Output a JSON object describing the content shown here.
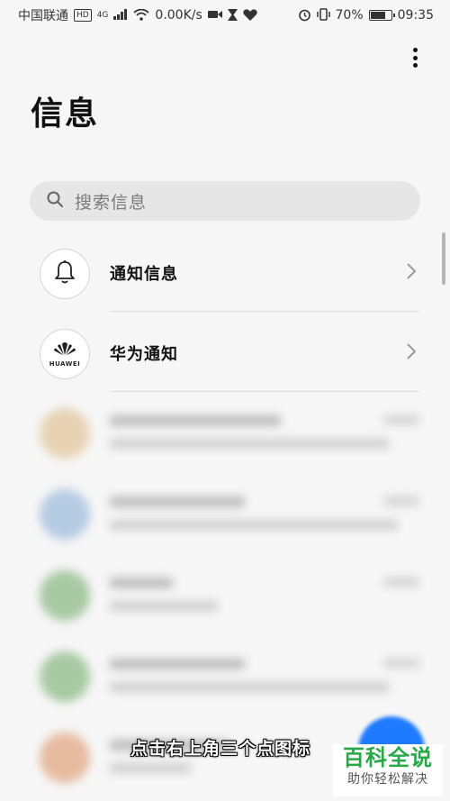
{
  "status_bar": {
    "carrier": "中国联通",
    "hd": "HD",
    "network": "4G",
    "speed": "0.00K/s",
    "battery": "70%",
    "battery_level": 0.7,
    "time": "09:35"
  },
  "header": {
    "title": "信息"
  },
  "search": {
    "placeholder": "搜索信息"
  },
  "list": {
    "items": [
      {
        "label": "通知信息",
        "icon": "bell-icon"
      },
      {
        "label": "华为通知",
        "icon": "huawei-logo-icon",
        "logo_text": "HUAWEI"
      }
    ]
  },
  "blurred_conversations": {
    "avatar_colors": [
      "#e7d3b4",
      "#b6cbe4",
      "#a8c9a3",
      "#a8c9a3",
      "#e7bba0"
    ]
  },
  "fab": {
    "color": "#1e7bff"
  },
  "caption": {
    "text": "点击右上角三个点图标"
  },
  "watermark": {
    "title": "百科全说",
    "subtitle": "助你轻松解决",
    "color": "#29a84a"
  }
}
